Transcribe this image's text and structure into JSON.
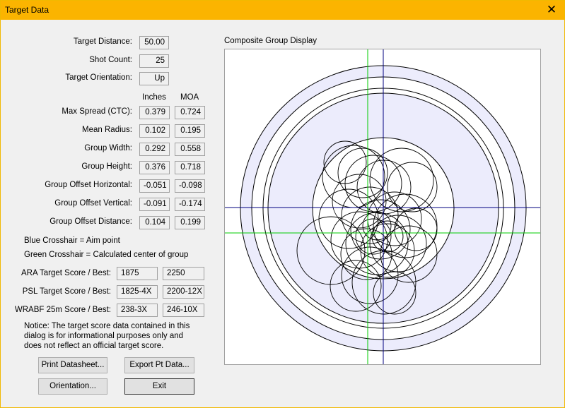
{
  "window": {
    "title": "Target Data"
  },
  "labels": {
    "target_distance": "Target Distance:",
    "shot_count": "Shot Count:",
    "target_orientation": "Target Orientation:",
    "col_inches": "Inches",
    "col_moa": "MOA",
    "max_spread": "Max Spread (CTC):",
    "mean_radius": "Mean Radius:",
    "group_width": "Group Width:",
    "group_height": "Group Height:",
    "offset_h": "Group Offset Horizontal:",
    "offset_v": "Group Offset Vertical:",
    "offset_d": "Group Offset Distance:",
    "legend_blue": "Blue Crosshair = Aim point",
    "legend_green": "Green Crosshair = Calculated center of group",
    "ara": "ARA Target Score / Best:",
    "psl": "PSL Target Score / Best:",
    "wrabf": "WRABF 25m Score / Best:",
    "plot_title": "Composite Group Display"
  },
  "values": {
    "target_distance": "50.00",
    "shot_count": "25",
    "target_orientation": "Up",
    "max_spread": {
      "inches": "0.379",
      "moa": "0.724"
    },
    "mean_radius": {
      "inches": "0.102",
      "moa": "0.195"
    },
    "group_width": {
      "inches": "0.292",
      "moa": "0.558"
    },
    "group_height": {
      "inches": "0.376",
      "moa": "0.718"
    },
    "offset_h": {
      "inches": "-0.051",
      "moa": "-0.098"
    },
    "offset_v": {
      "inches": "-0.091",
      "moa": "-0.174"
    },
    "offset_d": {
      "inches": "0.104",
      "moa": "0.199"
    },
    "ara": {
      "score": "1875",
      "best": "2250"
    },
    "psl": {
      "score": "1825-4X",
      "best": "2200-12X"
    },
    "wrabf": {
      "score": "238-3X",
      "best": "246-10X"
    }
  },
  "notice": "Notice: The target score data contained in this dialog is for informational purposes only and does not reflect an official target score.",
  "buttons": {
    "print": "Print Datasheet...",
    "export": "Export Pt Data...",
    "orientation": "Orientation...",
    "exit": "Exit"
  },
  "colors": {
    "titlebar": "#fbb400",
    "aim_crosshair": "#00007f",
    "center_crosshair": "#00cc00",
    "ring_fill": "#ececfc"
  }
}
